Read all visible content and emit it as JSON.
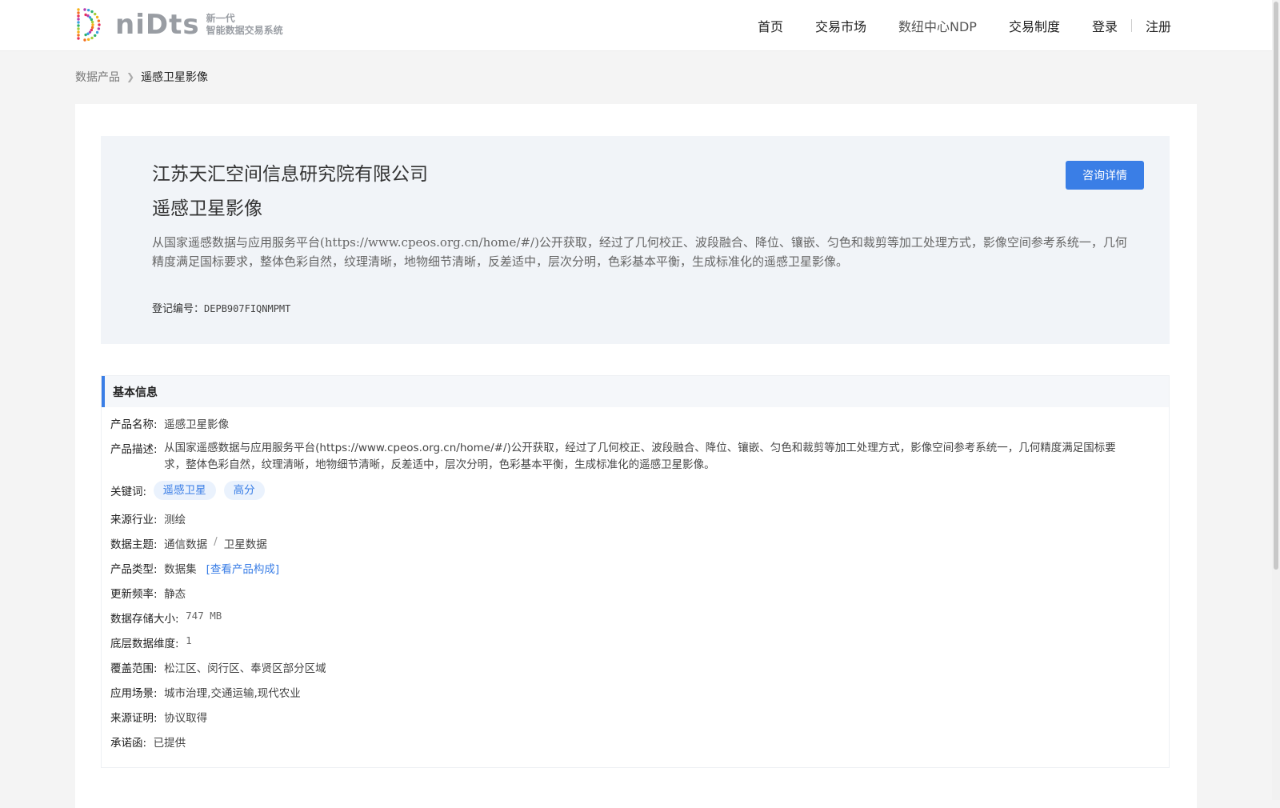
{
  "header": {
    "logo_word": "niDts",
    "logo_sub_line1": "新一代",
    "logo_sub_line2": "智能数据交易系统",
    "nav": [
      "首页",
      "交易市场",
      "数纽中心NDP",
      "交易制度"
    ],
    "login": "登录",
    "register": "注册"
  },
  "breadcrumb": {
    "parent": "数据产品",
    "current": "遥感卫星影像"
  },
  "hero": {
    "company": "江苏天汇空间信息研究院有限公司",
    "title": "遥感卫星影像",
    "description": "从国家遥感数据与应用服务平台(https://www.cpeos.org.cn/home/#/)公开获取，经过了几何校正、波段融合、降位、镶嵌、匀色和裁剪等加工处理方式，影像空间参考系统一，几何精度满足国标要求，整体色彩自然，纹理清晰，地物细节清晰，反差适中，层次分明，色彩基本平衡，生成标准化的遥感卫星影像。",
    "reg_label": "登记编号：",
    "reg_value": "DEPB907FIQNMPMT",
    "consult_button": "咨询详情"
  },
  "info": {
    "heading": "基本信息",
    "product_name_label": "产品名称:",
    "product_name": "遥感卫星影像",
    "product_desc_label": "产品描述:",
    "product_desc": "从国家遥感数据与应用服务平台(https://www.cpeos.org.cn/home/#/)公开获取，经过了几何校正、波段融合、降位、镶嵌、匀色和裁剪等加工处理方式，影像空间参考系统一，几何精度满足国标要求，整体色彩自然，纹理清晰，地物细节清晰，反差适中，层次分明，色彩基本平衡，生成标准化的遥感卫星影像。",
    "keywords_label": "关键词:",
    "keywords": [
      "遥感卫星",
      "高分"
    ],
    "industry_label": "来源行业:",
    "industry": "测绘",
    "theme_label": "数据主题:",
    "theme_1": "通信数据",
    "theme_sep": "/",
    "theme_2": "卫星数据",
    "type_label": "产品类型:",
    "type": "数据集",
    "type_link": "[查看产品构成]",
    "frequency_label": "更新频率:",
    "frequency": "静态",
    "size_label": "数据存储大小:",
    "size": "747 MB",
    "dimension_label": "底层数据维度:",
    "dimension": "1",
    "coverage_label": "覆盖范围:",
    "coverage": "松江区、闵行区、奉贤区部分区域",
    "scenario_label": "应用场景:",
    "scenario": "城市治理,交通运输,现代农业",
    "proof_label": "来源证明:",
    "proof": "协议取得",
    "letter_label": "承诺函:",
    "letter": "已提供"
  },
  "colors": {
    "accent": "#3a7ee6",
    "hero_bg": "#f1f4f8",
    "page_bg": "#f4f4f4",
    "tag_bg": "#eaf2fd"
  }
}
